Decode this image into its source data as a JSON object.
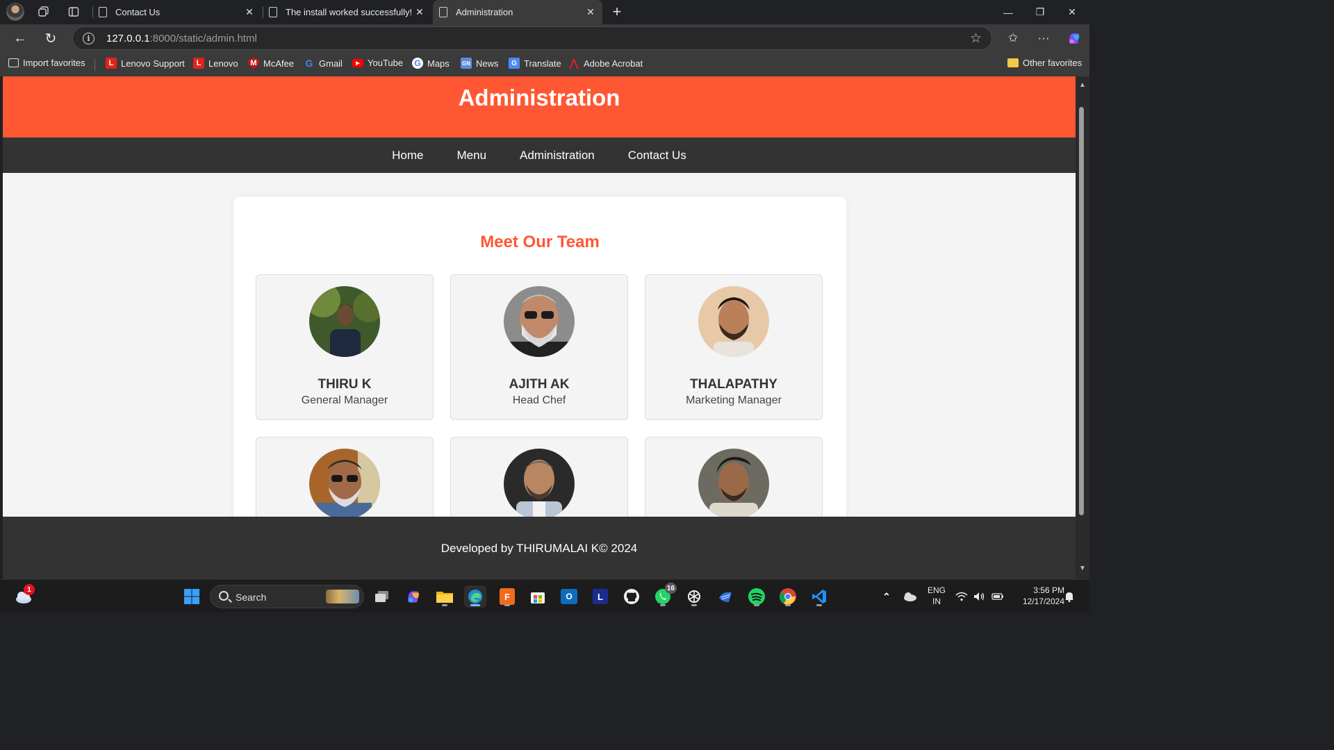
{
  "browser": {
    "tabs": [
      {
        "title": "Contact Us"
      },
      {
        "title": "The install worked successfully! Co"
      },
      {
        "title": "Administration"
      }
    ],
    "address_host": "127.0.0.1",
    "address_rest": ":8000/static/admin.html",
    "bookmarks": [
      {
        "label": "Import favorites",
        "icon": "import-icon"
      },
      {
        "label": "Lenovo Support",
        "icon": "lenovo-icon"
      },
      {
        "label": "Lenovo",
        "icon": "lenovo-icon"
      },
      {
        "label": "McAfee",
        "icon": "mcafee-icon"
      },
      {
        "label": "Gmail",
        "icon": "google-icon"
      },
      {
        "label": "YouTube",
        "icon": "youtube-icon"
      },
      {
        "label": "Maps",
        "icon": "maps-icon"
      },
      {
        "label": "News",
        "icon": "news-icon"
      },
      {
        "label": "Translate",
        "icon": "translate-icon"
      },
      {
        "label": "Adobe Acrobat",
        "icon": "acrobat-icon"
      }
    ],
    "other_favorites": "Other favorites"
  },
  "site": {
    "title": "Administration",
    "nav": [
      "Home",
      "Menu",
      "Administration",
      "Contact Us"
    ],
    "team_heading": "Meet Our Team",
    "members": [
      {
        "name": "THIRU K",
        "role": "General Manager"
      },
      {
        "name": "AJITH AK",
        "role": "Head Chef"
      },
      {
        "name": "THALAPATHY",
        "role": "Marketing Manager"
      },
      {
        "name": "",
        "role": ""
      },
      {
        "name": "",
        "role": ""
      },
      {
        "name": "",
        "role": ""
      }
    ],
    "footer": "Developed by THIRUMALAI K© 2024",
    "colors": {
      "accent": "#ff5733",
      "nav": "#333333",
      "page_bg": "#f4f4f4"
    }
  },
  "taskbar": {
    "search_label": "Search",
    "weather_badge": "1",
    "whatsapp_badge": "16",
    "lang_line1": "ENG",
    "lang_line2": "IN",
    "time": "3:56 PM",
    "date": "12/17/2024"
  }
}
